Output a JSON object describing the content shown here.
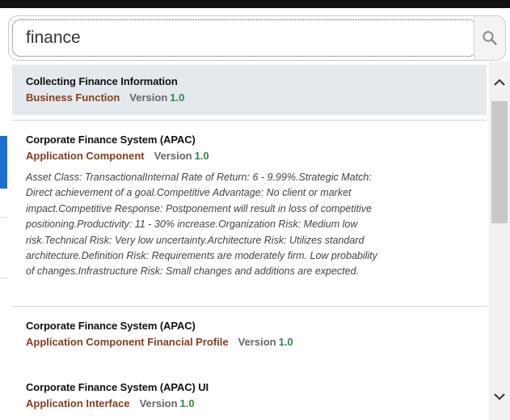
{
  "search": {
    "query": "finance",
    "icon": "magnifier"
  },
  "results": [
    {
      "title": "Collecting Finance Information",
      "type": "Business Function",
      "version_label": "Version",
      "version": "1.0",
      "selected": true
    },
    {
      "title": "Corporate Finance System (APAC)",
      "type": "Application Component",
      "version_label": "Version",
      "version": "1.0",
      "description_lines": [
        "Asset Class: TransactionalInternal Rate of Return: 6 - 9.99%.Strategic Match:",
        "Direct achievement of a goal.Competitive Advantage: No client or market",
        "impact.Competitive Response: Postponement will result in loss of competitive",
        "positioning.Productivity: 11 - 30% increase.Organization Risk: Medium low",
        "risk.Technical Risk: Very low uncertainty.Architecture Risk: Utilizes standard",
        "architecture.Definition Risk: Requirements are moderately firm. Low probability",
        "of changes.Infrastructure Risk: Small changes and additions are expected."
      ]
    },
    {
      "title": "Corporate Finance System (APAC)",
      "type": "Application Component Financial Profile",
      "version_label": "Version",
      "version": "1.0"
    },
    {
      "title": "Corporate Finance System (APAC) UI",
      "type": "Application Interface",
      "version_label": "Version",
      "version": "1.0"
    }
  ],
  "colors": {
    "type_text": "#8a3b1d",
    "version_number": "#2f8a49",
    "selected_row": "#e4e9ee",
    "accent_left": "#1a6fd1"
  }
}
